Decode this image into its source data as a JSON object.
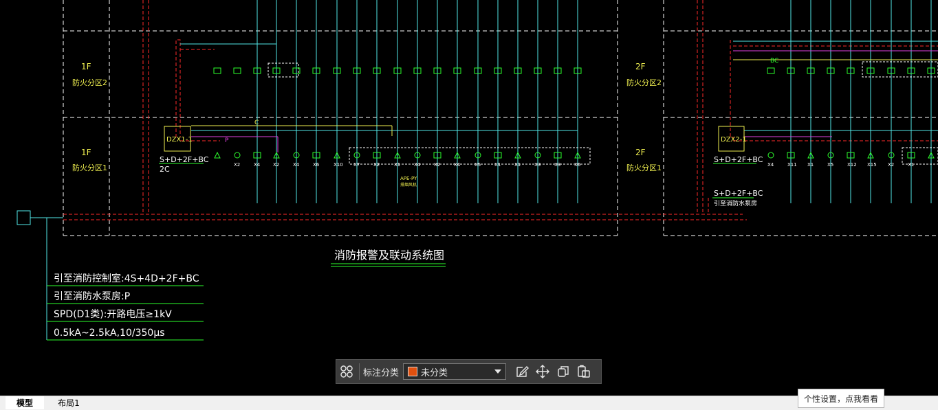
{
  "drawing": {
    "title": "消防报警及联动系统图",
    "floor_labels": {
      "f1_upper_floor": "1F",
      "f1_upper_zone": "防火分区2",
      "f1_lower_floor": "1F",
      "f1_lower_zone": "防火分区1",
      "f2_upper_floor": "2F",
      "f2_upper_zone": "防火分区2",
      "f2_lower_floor": "2F",
      "f2_lower_zone": "防火分区1"
    },
    "boxes": {
      "dzx1": "DZX1-1",
      "dzx2": "DZX2-1"
    },
    "box_labels": {
      "dzx1_cable": "S+D+2F+BC",
      "dzx1_count": "2C",
      "dzx2_cable": "S+D+2F+BC",
      "riser_cable": "S+D+2F+BC",
      "riser_note": "引至消防水泵房",
      "ape": "APE-PY",
      "ape_sub": "排烟风机",
      "bc_label": "BC",
      "wire_p": "P",
      "wire_c": "C"
    },
    "notes": [
      "引至消防控制室:4S+4D+2F+BC",
      "引至消防水泵房:P",
      "SPD(D1类):开路电压≥1kV",
      "0.5kA~2.5kA,10/350μs"
    ],
    "device_labels": [
      "X2",
      "X4",
      "X2",
      "X4",
      "X6",
      "X10",
      "X7",
      "X2",
      "X1",
      "X4",
      "X2",
      "X4",
      "X5",
      "X1",
      "X1",
      "X3",
      "X3",
      "X6",
      "X4",
      "X11",
      "X1",
      "X5",
      "X12",
      "X15",
      "X2",
      "X1"
    ],
    "colors": {
      "background": "#000000",
      "dashed_frame": "#ffffff",
      "riser": "#ff2a2a",
      "cyan_wire": "#52e8e8",
      "yellow_wire": "#f0f050",
      "magenta_wire": "#e040e0",
      "green": "#2dff2d",
      "device_white": "#e8e8e8"
    }
  },
  "toolbar": {
    "label": "标注分类",
    "category_value": "未分类",
    "category_color": "#e0500f",
    "icons": [
      "grid-icon",
      "edit-icon",
      "move-icon",
      "copy-icon",
      "paste-icon"
    ]
  },
  "tabs": {
    "model": "模型",
    "layout": "布局1"
  },
  "tooltip": {
    "text": "个性设置，点我看看"
  }
}
